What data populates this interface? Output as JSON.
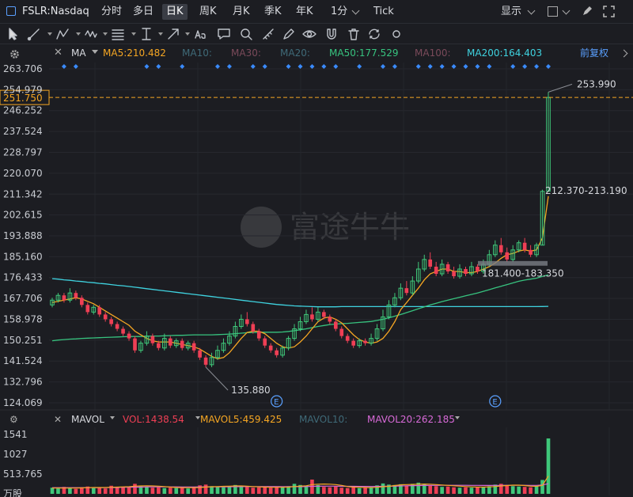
{
  "header": {
    "symbol": "FSLR:Nasdaq",
    "periods": [
      "分时",
      "多日",
      "日K",
      "周K",
      "月K",
      "季K",
      "年K",
      "1分",
      "Tick"
    ],
    "active_period": "日K",
    "display_label": "显示"
  },
  "toolbar_icons": [
    "cursor-icon",
    "line-tool-icon",
    "polyline-tool-icon",
    "wave-tool-icon",
    "fib-tool-icon",
    "price-line-icon",
    "arrow-tool-icon",
    "text-tool-icon",
    "comment-icon",
    "zoom-icon",
    "ruler-icon",
    "pen-icon",
    "eye-icon",
    "magnet-icon",
    "trash-icon",
    "sync-icon",
    "settings-icon"
  ],
  "ma_bar": {
    "type_label": "MA",
    "ma5": "MA5:210.482",
    "ma10": "MA10:",
    "ma30": "MA30:",
    "ma20": "MA20:",
    "ma50": "MA50:177.529",
    "ma100": "MA100:",
    "ma200": "MA200:164.403",
    "adjust_label": "前复权"
  },
  "vol_bar": {
    "type_label": "MAVOL",
    "vol": "VOL:1438.54",
    "mavol5": "MAVOL5:459.425",
    "mavol10": "MAVOL10:",
    "mavol20": "MAVOL20:262.185"
  },
  "annotations": {
    "current_price": "251.750",
    "high_label": "253.990",
    "gap_label": "212.370-213.190",
    "prev_gap_label": "181.400-183.350",
    "low_label": "135.880",
    "event_marker": "E",
    "watermark": "富途牛牛"
  },
  "colors": {
    "up": "#3fc87a",
    "down": "#ef3f55",
    "ma5": "#f5a623",
    "ma50": "#37c37f",
    "ma200": "#3fd3e0",
    "mavol5": "#f5a623",
    "mavol20": "#d86ad8",
    "price_line": "#f5a623"
  },
  "chart_data": {
    "type": "candlestick",
    "price_axis_ticks": [
      "263.706",
      "254.979",
      "246.252",
      "237.524",
      "228.797",
      "220.070",
      "211.342",
      "202.615",
      "193.888",
      "185.160",
      "176.433",
      "167.706",
      "158.978",
      "150.251",
      "141.524",
      "132.796",
      "124.069"
    ],
    "ylim": [
      124.069,
      263.706
    ],
    "volume_axis_ticks": [
      "1541",
      "1027",
      "513.765",
      "万股"
    ],
    "volume_ylim": [
      0,
      1541
    ],
    "candles": [
      [
        165,
        167,
        164,
        168,
        163
      ],
      [
        167,
        169,
        166,
        170,
        165
      ],
      [
        169,
        167,
        166,
        170,
        165
      ],
      [
        167,
        170,
        166,
        172,
        165
      ],
      [
        170,
        168,
        167,
        171,
        166
      ],
      [
        168,
        165,
        164,
        169,
        163
      ],
      [
        165,
        162,
        161,
        166,
        160
      ],
      [
        162,
        164,
        161,
        165,
        160
      ],
      [
        164,
        161,
        160,
        165,
        159
      ],
      [
        161,
        159,
        158,
        162,
        157
      ],
      [
        159,
        157,
        156,
        160,
        155
      ],
      [
        157,
        155,
        154,
        158,
        153
      ],
      [
        155,
        153,
        152,
        156,
        151
      ],
      [
        153,
        151,
        150,
        154,
        149
      ],
      [
        151,
        146,
        145,
        152,
        144
      ],
      [
        146,
        149,
        145,
        150,
        144
      ],
      [
        149,
        152,
        148,
        154,
        147
      ],
      [
        152,
        149,
        148,
        153,
        147
      ],
      [
        149,
        147,
        146,
        150,
        144
      ],
      [
        147,
        151,
        146,
        153,
        145
      ],
      [
        151,
        148,
        147,
        152,
        146
      ],
      [
        148,
        150,
        147,
        151,
        146
      ],
      [
        150,
        147,
        146,
        151,
        145
      ],
      [
        147,
        149,
        146,
        150,
        144
      ],
      [
        149,
        146,
        145,
        150,
        143
      ],
      [
        146,
        143,
        142,
        147,
        141
      ],
      [
        143,
        140,
        139,
        144,
        137
      ],
      [
        140,
        143,
        139,
        145,
        136
      ],
      [
        143,
        146,
        142,
        148,
        141
      ],
      [
        146,
        149,
        145,
        151,
        144
      ],
      [
        149,
        152,
        148,
        154,
        147
      ],
      [
        152,
        156,
        151,
        158,
        150
      ],
      [
        156,
        159,
        155,
        161,
        154
      ],
      [
        159,
        157,
        156,
        162,
        155
      ],
      [
        157,
        154,
        153,
        158,
        152
      ],
      [
        154,
        151,
        150,
        155,
        149
      ],
      [
        151,
        148,
        147,
        152,
        146
      ],
      [
        148,
        146,
        145,
        149,
        144
      ],
      [
        146,
        144,
        143,
        147,
        142
      ],
      [
        144,
        147,
        143,
        148,
        142
      ],
      [
        147,
        151,
        146,
        152,
        145
      ],
      [
        151,
        155,
        150,
        157,
        149
      ],
      [
        155,
        158,
        154,
        160,
        153
      ],
      [
        158,
        161,
        157,
        163,
        156
      ],
      [
        161,
        159,
        158,
        164,
        157
      ],
      [
        159,
        162,
        158,
        164,
        157
      ],
      [
        162,
        160,
        159,
        163,
        158
      ],
      [
        160,
        158,
        157,
        161,
        156
      ],
      [
        158,
        155,
        154,
        159,
        153
      ],
      [
        155,
        152,
        151,
        156,
        150
      ],
      [
        152,
        150,
        149,
        153,
        148
      ],
      [
        150,
        148,
        147,
        151,
        146
      ],
      [
        148,
        150,
        147,
        151,
        146
      ],
      [
        150,
        149,
        148,
        151,
        147
      ],
      [
        149,
        151,
        148,
        153,
        147
      ],
      [
        151,
        155,
        150,
        157,
        149
      ],
      [
        155,
        160,
        154,
        163,
        153
      ],
      [
        160,
        165,
        159,
        167,
        158
      ],
      [
        165,
        168,
        164,
        170,
        163
      ],
      [
        168,
        172,
        167,
        174,
        166
      ],
      [
        172,
        170,
        169,
        175,
        168
      ],
      [
        170,
        175,
        169,
        177,
        168
      ],
      [
        175,
        180,
        174,
        183,
        173
      ],
      [
        180,
        184,
        179,
        186,
        178
      ],
      [
        184,
        181,
        180,
        187,
        179
      ],
      [
        181,
        178,
        177,
        183,
        176
      ],
      [
        178,
        182,
        177,
        184,
        176
      ],
      [
        182,
        179,
        178,
        183,
        177
      ],
      [
        179,
        177,
        176,
        181,
        175
      ],
      [
        177,
        180,
        176,
        182,
        175
      ],
      [
        180,
        178,
        177,
        181,
        176
      ],
      [
        178,
        181,
        177,
        183,
        176
      ],
      [
        181,
        179,
        178,
        182,
        177
      ],
      [
        179,
        182,
        178,
        184,
        177
      ],
      [
        182,
        186,
        181,
        188,
        180
      ],
      [
        186,
        190,
        185,
        192,
        184
      ],
      [
        190,
        187,
        186,
        193,
        185
      ],
      [
        187,
        184,
        183,
        189,
        182
      ],
      [
        184,
        188,
        183,
        190,
        182
      ],
      [
        188,
        191,
        187,
        192,
        186
      ],
      [
        191,
        188,
        187,
        193,
        186
      ],
      [
        188,
        186,
        185,
        190,
        184
      ],
      [
        186,
        190,
        185,
        191,
        184
      ],
      [
        190,
        212.5,
        190,
        213.19,
        189
      ],
      [
        212.5,
        251.75,
        212.37,
        253.99,
        212
      ]
    ],
    "volumes": [
      160,
      140,
      180,
      150,
      130,
      170,
      190,
      150,
      160,
      140,
      210,
      180,
      170,
      190,
      260,
      200,
      180,
      160,
      170,
      150,
      160,
      150,
      170,
      140,
      180,
      220,
      240,
      200,
      180,
      170,
      190,
      230,
      210,
      180,
      160,
      170,
      180,
      160,
      190,
      170,
      200,
      260,
      230,
      210,
      370,
      230,
      180,
      170,
      190,
      160,
      150,
      170,
      150,
      160,
      180,
      220,
      270,
      240,
      230,
      250,
      210,
      260,
      290,
      250,
      210,
      200,
      180,
      190,
      170,
      160,
      170,
      160,
      170,
      180,
      200,
      240,
      260,
      210,
      200,
      190,
      180,
      170,
      200,
      360,
      1438.54
    ],
    "ma5": [
      166,
      166.5,
      167,
      167.5,
      168,
      167.5,
      166.5,
      165.5,
      164,
      162.5,
      161,
      159.5,
      158,
      156.5,
      154,
      152.5,
      151,
      150,
      149.5,
      149.5,
      149.5,
      149,
      148.5,
      148,
      147.5,
      146.5,
      145,
      143.5,
      142.5,
      143,
      145,
      148,
      151,
      153.5,
      154,
      154,
      153,
      151,
      149,
      147.5,
      147,
      147.5,
      149.5,
      152,
      155,
      158,
      159.5,
      160,
      159,
      157.5,
      155,
      152.5,
      150.5,
      149.5,
      149,
      149.5,
      151,
      154,
      158,
      163,
      166,
      169,
      172,
      175.5,
      178,
      179,
      180,
      180,
      179,
      179,
      178.5,
      178.5,
      179,
      180,
      181,
      182.5,
      184.5,
      186,
      186.5,
      187.5,
      188,
      187.5,
      188,
      193,
      210.48
    ],
    "ma50": [
      150,
      150.3,
      150.5,
      150.7,
      150.8,
      151,
      151.1,
      151.2,
      151.3,
      151.4,
      151.5,
      151.6,
      151.7,
      151.8,
      151.8,
      151.8,
      151.9,
      152,
      152,
      152.1,
      152.2,
      152.3,
      152.3,
      152.4,
      152.5,
      152.5,
      152.5,
      152.5,
      152.6,
      152.7,
      152.8,
      153,
      153.2,
      153.4,
      153.5,
      153.6,
      153.6,
      153.6,
      153.6,
      153.7,
      153.9,
      154.2,
      154.6,
      155,
      155.5,
      156,
      156.4,
      156.8,
      157,
      157.2,
      157.3,
      157.5,
      157.7,
      157.9,
      158.1,
      158.5,
      159,
      159.6,
      160.3,
      161,
      161.8,
      162.6,
      163.4,
      164.2,
      165,
      165.7,
      166.4,
      167,
      167.6,
      168.2,
      168.8,
      169.4,
      170,
      170.7,
      171.4,
      172.1,
      172.8,
      173.5,
      174.2,
      174.9,
      175.4,
      175.8,
      176.2,
      176.9,
      177.53
    ],
    "ma200": [
      176,
      175.8,
      175.5,
      175.3,
      175,
      174.8,
      174.5,
      174.3,
      174,
      173.8,
      173.5,
      173.2,
      173,
      172.7,
      172.4,
      172.1,
      171.8,
      171.5,
      171.2,
      170.9,
      170.6,
      170.3,
      170,
      169.7,
      169.4,
      169.1,
      168.8,
      168.5,
      168.2,
      167.9,
      167.6,
      167.3,
      167,
      166.7,
      166.4,
      166.1,
      165.8,
      165.5,
      165.2,
      165,
      164.8,
      164.6,
      164.5,
      164.4,
      164.3,
      164.2,
      164.2,
      164.2,
      164.2,
      164.3,
      164.3,
      164.3,
      164.3,
      164.3,
      164.3,
      164.3,
      164.3,
      164.3,
      164.3,
      164.3,
      164.3,
      164.3,
      164.3,
      164.3,
      164.3,
      164.3,
      164.3,
      164.3,
      164.3,
      164.3,
      164.3,
      164.3,
      164.3,
      164.3,
      164.3,
      164.3,
      164.3,
      164.3,
      164.3,
      164.3,
      164.3,
      164.3,
      164.3,
      164.35,
      164.4
    ],
    "mavol5": [
      150,
      150,
      150,
      150,
      150,
      155,
      160,
      165,
      165,
      165,
      170,
      175,
      180,
      185,
      200,
      205,
      210,
      205,
      200,
      190,
      175,
      165,
      160,
      160,
      160,
      165,
      175,
      185,
      190,
      195,
      200,
      205,
      205,
      200,
      190,
      180,
      175,
      170,
      170,
      170,
      175,
      190,
      200,
      210,
      240,
      250,
      255,
      250,
      240,
      220,
      190,
      175,
      170,
      165,
      160,
      170,
      185,
      195,
      215,
      235,
      240,
      245,
      250,
      255,
      250,
      240,
      230,
      220,
      210,
      200,
      190,
      180,
      175,
      175,
      180,
      190,
      205,
      215,
      225,
      225,
      215,
      200,
      195,
      220,
      459.43
    ],
    "mavol20": [
      160,
      160,
      160,
      160,
      160,
      160,
      160,
      160,
      160,
      160,
      165,
      165,
      170,
      170,
      175,
      175,
      180,
      180,
      180,
      180,
      180,
      180,
      178,
      178,
      178,
      180,
      180,
      180,
      180,
      182,
      184,
      186,
      188,
      190,
      190,
      190,
      190,
      188,
      186,
      185,
      185,
      186,
      188,
      190,
      195,
      198,
      200,
      200,
      200,
      198,
      196,
      195,
      194,
      193,
      192,
      194,
      196,
      198,
      200,
      205,
      210,
      213,
      216,
      218,
      220,
      220,
      221,
      222,
      222,
      222,
      221,
      220,
      219,
      218,
      218,
      219,
      220,
      221,
      222,
      222,
      221,
      220,
      220,
      230,
      262.19
    ],
    "event_marker_indices": [
      38,
      75
    ]
  }
}
